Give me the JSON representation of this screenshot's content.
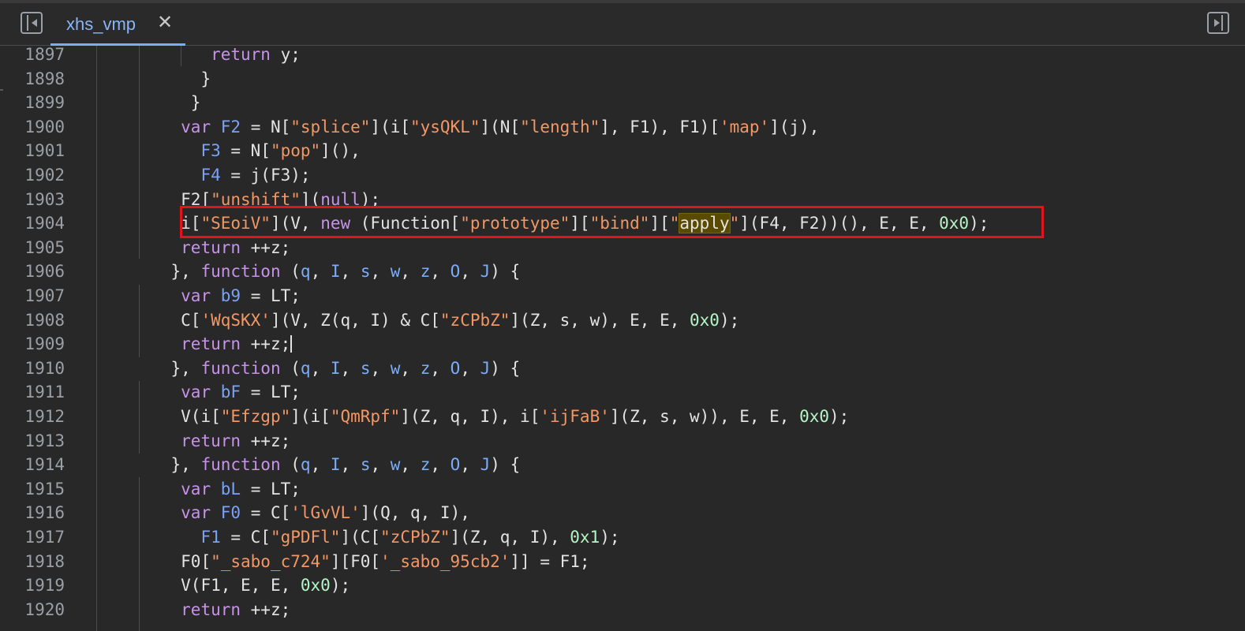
{
  "tab": {
    "title": "xhs_vmp",
    "close": "✕"
  },
  "icons": {
    "nav_toggle": "sidebar-left-toggle-icon",
    "pane_toggle": "sidebar-right-toggle-icon",
    "close": "close-icon"
  },
  "colors": {
    "background": "#282828",
    "keyword": "#c792ea",
    "string": "#f29766",
    "identifier": "#7aa2f7",
    "number": "#b5f5c5",
    "highlight_box": "#e0141b"
  },
  "editor": {
    "highlighted_line": "1904",
    "search_match": "apply",
    "lines": [
      {
        "n": "1897",
        "indent": 11,
        "tokens": [
          [
            "kw",
            "return"
          ],
          [
            "p",
            " y;"
          ]
        ]
      },
      {
        "n": "1898",
        "indent": 10,
        "tokens": [
          [
            "p",
            "}"
          ]
        ]
      },
      {
        "n": "1899",
        "indent": 9,
        "tokens": [
          [
            "p",
            "}"
          ]
        ]
      },
      {
        "n": "1900",
        "indent": 8,
        "tokens": [
          [
            "kw",
            "var"
          ],
          [
            "p",
            " "
          ],
          [
            "var",
            "F2"
          ],
          [
            "p",
            " = N["
          ],
          [
            "str",
            "\"splice\""
          ],
          [
            "p",
            "](i["
          ],
          [
            "str",
            "\"ysQKL\""
          ],
          [
            "p",
            "](N["
          ],
          [
            "str",
            "\"length\""
          ],
          [
            "p",
            "], F1), F1)["
          ],
          [
            "str",
            "'map'"
          ],
          [
            "p",
            "](j),"
          ]
        ]
      },
      {
        "n": "1901",
        "indent": 10,
        "tokens": [
          [
            "var",
            "F3"
          ],
          [
            "p",
            " = N["
          ],
          [
            "str",
            "\"pop\""
          ],
          [
            "p",
            "](),"
          ]
        ]
      },
      {
        "n": "1902",
        "indent": 10,
        "tokens": [
          [
            "var",
            "F4"
          ],
          [
            "p",
            " = j(F3);"
          ]
        ]
      },
      {
        "n": "1903",
        "indent": 8,
        "tokens": [
          [
            "p",
            "F2["
          ],
          [
            "str",
            "\"unshift\""
          ],
          [
            "p",
            "]("
          ],
          [
            "kw",
            "null"
          ],
          [
            "p",
            ");"
          ]
        ]
      },
      {
        "n": "1904",
        "indent": 8,
        "tokens": [
          [
            "p",
            "i["
          ],
          [
            "str",
            "\"SEoiV\""
          ],
          [
            "p",
            "](V, "
          ],
          [
            "kw",
            "new"
          ],
          [
            "p",
            " (Function["
          ],
          [
            "str",
            "\"prototype\""
          ],
          [
            "p",
            "]["
          ],
          [
            "str",
            "\"bind\""
          ],
          [
            "p",
            "]["
          ],
          [
            "str",
            "\""
          ],
          [
            "hl",
            "apply"
          ],
          [
            "str",
            "\""
          ],
          [
            "p",
            "](F4, F2))(), E, E, "
          ],
          [
            "num",
            "0x0"
          ],
          [
            "p",
            ");"
          ]
        ]
      },
      {
        "n": "1905",
        "indent": 8,
        "tokens": [
          [
            "kw",
            "return"
          ],
          [
            "p",
            " ++z;"
          ]
        ]
      },
      {
        "n": "1906",
        "indent": 7,
        "tokens": [
          [
            "p",
            "}, "
          ],
          [
            "kw",
            "function"
          ],
          [
            "p",
            " ("
          ],
          [
            "param",
            "q"
          ],
          [
            "p",
            ", "
          ],
          [
            "param",
            "I"
          ],
          [
            "p",
            ", "
          ],
          [
            "param",
            "s"
          ],
          [
            "p",
            ", "
          ],
          [
            "param",
            "w"
          ],
          [
            "p",
            ", "
          ],
          [
            "param",
            "z"
          ],
          [
            "p",
            ", "
          ],
          [
            "param",
            "O"
          ],
          [
            "p",
            ", "
          ],
          [
            "param",
            "J"
          ],
          [
            "p",
            ") {"
          ]
        ]
      },
      {
        "n": "1907",
        "indent": 8,
        "tokens": [
          [
            "kw",
            "var"
          ],
          [
            "p",
            " "
          ],
          [
            "var",
            "b9"
          ],
          [
            "p",
            " = LT;"
          ]
        ]
      },
      {
        "n": "1908",
        "indent": 8,
        "tokens": [
          [
            "p",
            "C["
          ],
          [
            "str",
            "'WqSKX'"
          ],
          [
            "p",
            "](V, Z(q, I) & C["
          ],
          [
            "str",
            "\"zCPbZ\""
          ],
          [
            "p",
            "](Z, s, w), E, E, "
          ],
          [
            "num",
            "0x0"
          ],
          [
            "p",
            ");"
          ]
        ]
      },
      {
        "n": "1909",
        "indent": 8,
        "tokens": [
          [
            "kw",
            "return"
          ],
          [
            "p",
            " ++z;"
          ],
          [
            "caret",
            ""
          ]
        ]
      },
      {
        "n": "1910",
        "indent": 7,
        "tokens": [
          [
            "p",
            "}, "
          ],
          [
            "kw",
            "function"
          ],
          [
            "p",
            " ("
          ],
          [
            "param",
            "q"
          ],
          [
            "p",
            ", "
          ],
          [
            "param",
            "I"
          ],
          [
            "p",
            ", "
          ],
          [
            "param",
            "s"
          ],
          [
            "p",
            ", "
          ],
          [
            "param",
            "w"
          ],
          [
            "p",
            ", "
          ],
          [
            "param",
            "z"
          ],
          [
            "p",
            ", "
          ],
          [
            "param",
            "O"
          ],
          [
            "p",
            ", "
          ],
          [
            "param",
            "J"
          ],
          [
            "p",
            ") {"
          ]
        ]
      },
      {
        "n": "1911",
        "indent": 8,
        "tokens": [
          [
            "kw",
            "var"
          ],
          [
            "p",
            " "
          ],
          [
            "var",
            "bF"
          ],
          [
            "p",
            " = LT;"
          ]
        ]
      },
      {
        "n": "1912",
        "indent": 8,
        "tokens": [
          [
            "p",
            "V(i["
          ],
          [
            "str",
            "\"Efzgp\""
          ],
          [
            "p",
            "](i["
          ],
          [
            "str",
            "\"QmRpf\""
          ],
          [
            "p",
            "](Z, q, I), i["
          ],
          [
            "str",
            "'ijFaB'"
          ],
          [
            "p",
            "](Z, s, w)), E, E, "
          ],
          [
            "num",
            "0x0"
          ],
          [
            "p",
            ");"
          ]
        ]
      },
      {
        "n": "1913",
        "indent": 8,
        "tokens": [
          [
            "kw",
            "return"
          ],
          [
            "p",
            " ++z;"
          ]
        ]
      },
      {
        "n": "1914",
        "indent": 7,
        "tokens": [
          [
            "p",
            "}, "
          ],
          [
            "kw",
            "function"
          ],
          [
            "p",
            " ("
          ],
          [
            "param",
            "q"
          ],
          [
            "p",
            ", "
          ],
          [
            "param",
            "I"
          ],
          [
            "p",
            ", "
          ],
          [
            "param",
            "s"
          ],
          [
            "p",
            ", "
          ],
          [
            "param",
            "w"
          ],
          [
            "p",
            ", "
          ],
          [
            "param",
            "z"
          ],
          [
            "p",
            ", "
          ],
          [
            "param",
            "O"
          ],
          [
            "p",
            ", "
          ],
          [
            "param",
            "J"
          ],
          [
            "p",
            ") {"
          ]
        ]
      },
      {
        "n": "1915",
        "indent": 8,
        "tokens": [
          [
            "kw",
            "var"
          ],
          [
            "p",
            " "
          ],
          [
            "var",
            "bL"
          ],
          [
            "p",
            " = LT;"
          ]
        ]
      },
      {
        "n": "1916",
        "indent": 8,
        "tokens": [
          [
            "kw",
            "var"
          ],
          [
            "p",
            " "
          ],
          [
            "var",
            "F0"
          ],
          [
            "p",
            " = C["
          ],
          [
            "str",
            "'lGvVL'"
          ],
          [
            "p",
            "](Q, q, I),"
          ]
        ]
      },
      {
        "n": "1917",
        "indent": 10,
        "tokens": [
          [
            "var",
            "F1"
          ],
          [
            "p",
            " = C["
          ],
          [
            "str",
            "\"gPDFl\""
          ],
          [
            "p",
            "](C["
          ],
          [
            "str",
            "\"zCPbZ\""
          ],
          [
            "p",
            "](Z, q, I), "
          ],
          [
            "num",
            "0x1"
          ],
          [
            "p",
            ");"
          ]
        ]
      },
      {
        "n": "1918",
        "indent": 8,
        "tokens": [
          [
            "p",
            "F0["
          ],
          [
            "str",
            "\"_sabo_c724\""
          ],
          [
            "p",
            "][F0["
          ],
          [
            "str",
            "'_sabo_95cb2'"
          ],
          [
            "p",
            "]] = F1;"
          ]
        ]
      },
      {
        "n": "1919",
        "indent": 8,
        "tokens": [
          [
            "p",
            "V(F1, E, E, "
          ],
          [
            "num",
            "0x0"
          ],
          [
            "p",
            ");"
          ]
        ]
      },
      {
        "n": "1920",
        "indent": 8,
        "tokens": [
          [
            "kw",
            "return"
          ],
          [
            "p",
            " ++z;"
          ]
        ]
      }
    ]
  }
}
